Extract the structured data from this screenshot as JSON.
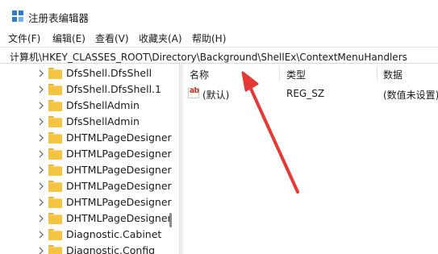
{
  "window": {
    "title": "注册表编辑器",
    "icon": "registry-editor-icon"
  },
  "menu": [
    "文件(F)",
    "编辑(E)",
    "查看(V)",
    "收藏夹(A)",
    "帮助(H)"
  ],
  "address": {
    "path": "计算机\\HKEY_CLASSES_ROOT\\Directory\\Background\\ShellEx\\ContextMenuHandlers"
  },
  "tree": {
    "items": [
      "DfsShell.DfsShell",
      "DfsShell.DfsShell.1",
      "DfsShellAdmin",
      "DfsShellAdmin",
      "DHTMLPageDesigner",
      "DHTMLPageDesigner",
      "DHTMLPageDesigner",
      "DHTMLPageDesigner",
      "DHTMLPageDesigner",
      "DHTMLPageDesigner",
      "Diagnostic.Cabinet",
      "Diagnostic.Config"
    ]
  },
  "columns": {
    "name": "名称",
    "type": "类型",
    "data": "数据"
  },
  "values": [
    {
      "name": "(默认)",
      "type": "REG_SZ",
      "data": "(数值未设置)"
    }
  ],
  "colors": {
    "folder": "#f6c443",
    "annotation_arrow": "#e53935",
    "string_value_icon": "#c42b1c"
  }
}
